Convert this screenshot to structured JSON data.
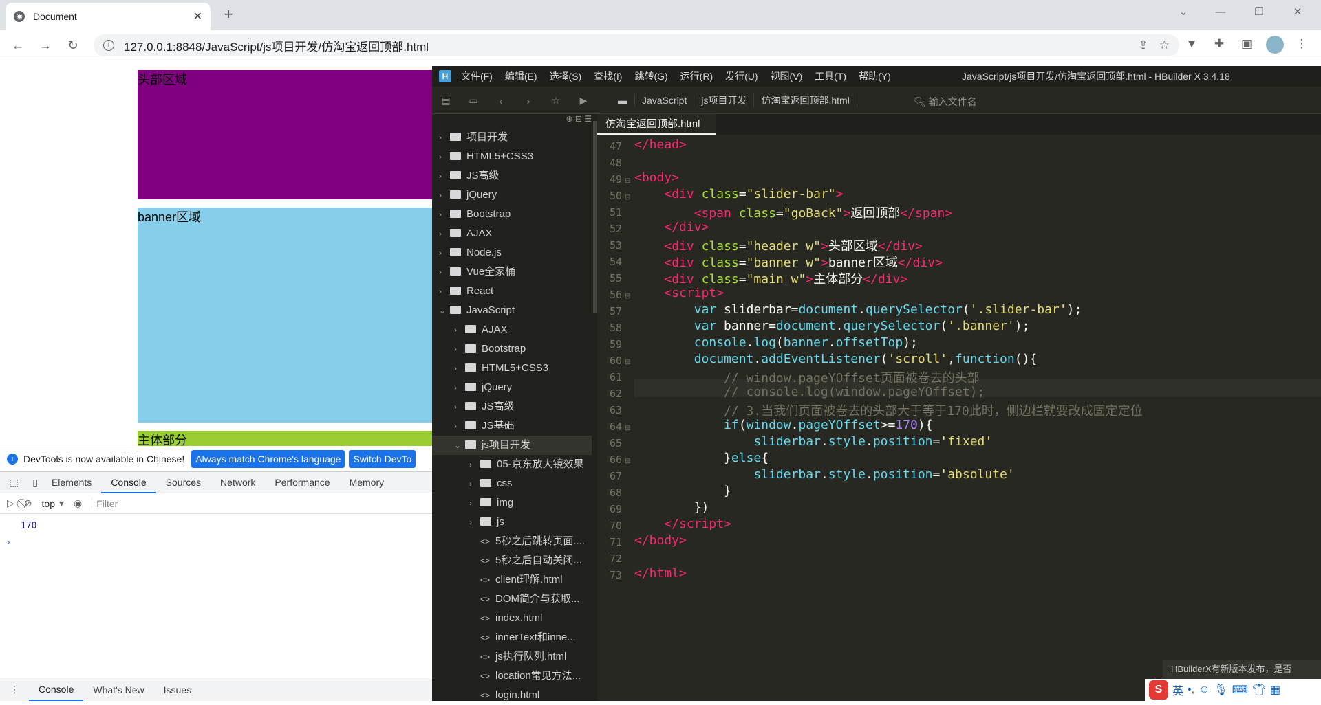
{
  "browser": {
    "tab_title": "Document",
    "url": "127.0.0.1:8848/JavaScript/js项目开发/仿淘宝返回顶部.html"
  },
  "page": {
    "header_text": "头部区域",
    "banner_text": "banner区域",
    "main_text": "主体部分",
    "colors": {
      "header": "#800080",
      "banner": "#87ceeb",
      "main": "#9acd32"
    }
  },
  "devtools": {
    "notice": "DevTools is now available in Chinese!",
    "btn_match": "Always match Chrome's language",
    "btn_switch": "Switch DevTo",
    "tabs": [
      "Elements",
      "Console",
      "Sources",
      "Network",
      "Performance",
      "Memory"
    ],
    "context": "top",
    "filter_placeholder": "Filter",
    "console_output": "170",
    "prompt": "›",
    "drawer_tabs": [
      "Console",
      "What's New",
      "Issues"
    ]
  },
  "hbuilder": {
    "menus": [
      "文件(F)",
      "编辑(E)",
      "选择(S)",
      "查找(I)",
      "跳转(G)",
      "运行(R)",
      "发行(U)",
      "视图(V)",
      "工具(T)",
      "帮助(Y)"
    ],
    "window_title": "JavaScript/js项目开发/仿淘宝返回顶部.html - HBuilder X 3.4.18",
    "breadcrumb": [
      "JavaScript",
      "js项目开发",
      "仿淘宝返回顶部.html"
    ],
    "file_search_placeholder": "输入文件名",
    "editor_tab": "仿淘宝返回顶部.html",
    "tree": [
      {
        "label": "项目开发",
        "type": "folder",
        "depth": 0,
        "open": false
      },
      {
        "label": "HTML5+CSS3",
        "type": "folder",
        "depth": 0,
        "open": false
      },
      {
        "label": "JS高级",
        "type": "folder",
        "depth": 0,
        "open": false
      },
      {
        "label": "jQuery",
        "type": "folder",
        "depth": 0,
        "open": false
      },
      {
        "label": "Bootstrap",
        "type": "folder",
        "depth": 0,
        "open": false
      },
      {
        "label": "AJAX",
        "type": "folder",
        "depth": 0,
        "open": false
      },
      {
        "label": "Node.js",
        "type": "folder",
        "depth": 0,
        "open": false
      },
      {
        "label": "Vue全家桶",
        "type": "folder",
        "depth": 0,
        "open": false
      },
      {
        "label": "React",
        "type": "folder",
        "depth": 0,
        "open": false
      },
      {
        "label": "JavaScript",
        "type": "folder",
        "depth": 0,
        "open": true
      },
      {
        "label": "AJAX",
        "type": "folder",
        "depth": 1,
        "open": false
      },
      {
        "label": "Bootstrap",
        "type": "folder",
        "depth": 1,
        "open": false
      },
      {
        "label": "HTML5+CSS3",
        "type": "folder",
        "depth": 1,
        "open": false
      },
      {
        "label": "jQuery",
        "type": "folder",
        "depth": 1,
        "open": false
      },
      {
        "label": "JS高级",
        "type": "folder",
        "depth": 1,
        "open": false
      },
      {
        "label": "JS基础",
        "type": "folder",
        "depth": 1,
        "open": false
      },
      {
        "label": "js项目开发",
        "type": "folder",
        "depth": 1,
        "open": true
      },
      {
        "label": "05-京东放大镜效果",
        "type": "folder",
        "depth": 2,
        "open": false
      },
      {
        "label": "css",
        "type": "folder",
        "depth": 2,
        "open": false
      },
      {
        "label": "img",
        "type": "folder",
        "depth": 2,
        "open": false
      },
      {
        "label": "js",
        "type": "folder",
        "depth": 2,
        "open": false
      },
      {
        "label": "5秒之后跳转页面....",
        "type": "file",
        "depth": 2
      },
      {
        "label": "5秒之后自动关闭...",
        "type": "file",
        "depth": 2
      },
      {
        "label": "client理解.html",
        "type": "file",
        "depth": 2
      },
      {
        "label": "DOM简介与获取...",
        "type": "file",
        "depth": 2
      },
      {
        "label": "index.html",
        "type": "file",
        "depth": 2
      },
      {
        "label": "innerText和inne...",
        "type": "file",
        "depth": 2
      },
      {
        "label": "js执行队列.html",
        "type": "file",
        "depth": 2
      },
      {
        "label": "location常见方法...",
        "type": "file",
        "depth": 2
      },
      {
        "label": "login.html",
        "type": "file",
        "depth": 2
      }
    ],
    "line_numbers": [
      "47",
      "48",
      "49",
      "50",
      "51",
      "52",
      "53",
      "54",
      "55",
      "56",
      "57",
      "58",
      "59",
      "60",
      "61",
      "62",
      "63",
      "64",
      "65",
      "66",
      "67",
      "68",
      "69",
      "70",
      "71",
      "72",
      "73"
    ],
    "notice": "HBuilderX有新版本发布，是否",
    "ime": "英"
  }
}
